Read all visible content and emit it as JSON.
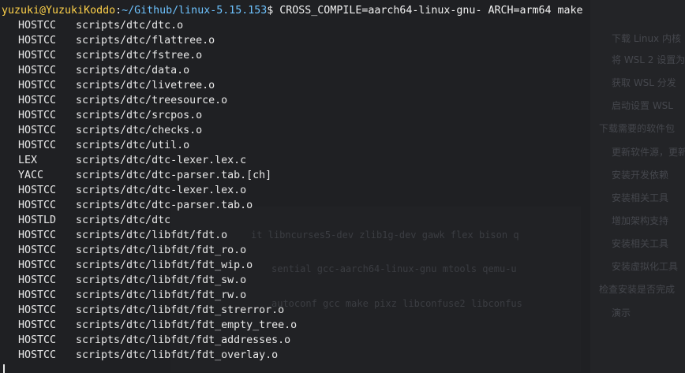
{
  "prompt": {
    "user_host": "yuzuki@YuzukiKoddo",
    "separator": ":",
    "cwd": "~/Github/linux-5.15.153",
    "symbol": "$",
    "command": " CROSS_COMPILE=aarch64-linux-gnu- ARCH=arm64 make"
  },
  "output_lines": [
    {
      "tag": "HOSTCC",
      "path": "scripts/dtc/dtc.o"
    },
    {
      "tag": "HOSTCC",
      "path": "scripts/dtc/flattree.o"
    },
    {
      "tag": "HOSTCC",
      "path": "scripts/dtc/fstree.o"
    },
    {
      "tag": "HOSTCC",
      "path": "scripts/dtc/data.o"
    },
    {
      "tag": "HOSTCC",
      "path": "scripts/dtc/livetree.o"
    },
    {
      "tag": "HOSTCC",
      "path": "scripts/dtc/treesource.o"
    },
    {
      "tag": "HOSTCC",
      "path": "scripts/dtc/srcpos.o"
    },
    {
      "tag": "HOSTCC",
      "path": "scripts/dtc/checks.o"
    },
    {
      "tag": "HOSTCC",
      "path": "scripts/dtc/util.o"
    },
    {
      "tag": "LEX",
      "path": "scripts/dtc/dtc-lexer.lex.c"
    },
    {
      "tag": "YACC",
      "path": "scripts/dtc/dtc-parser.tab.[ch]"
    },
    {
      "tag": "HOSTCC",
      "path": "scripts/dtc/dtc-lexer.lex.o"
    },
    {
      "tag": "HOSTCC",
      "path": "scripts/dtc/dtc-parser.tab.o"
    },
    {
      "tag": "HOSTLD",
      "path": "scripts/dtc/dtc"
    },
    {
      "tag": "HOSTCC",
      "path": "scripts/dtc/libfdt/fdt.o"
    },
    {
      "tag": "HOSTCC",
      "path": "scripts/dtc/libfdt/fdt_ro.o"
    },
    {
      "tag": "HOSTCC",
      "path": "scripts/dtc/libfdt/fdt_wip.o"
    },
    {
      "tag": "HOSTCC",
      "path": "scripts/dtc/libfdt/fdt_sw.o"
    },
    {
      "tag": "HOSTCC",
      "path": "scripts/dtc/libfdt/fdt_rw.o"
    },
    {
      "tag": "HOSTCC",
      "path": "scripts/dtc/libfdt/fdt_strerror.o"
    },
    {
      "tag": "HOSTCC",
      "path": "scripts/dtc/libfdt/fdt_empty_tree.o"
    },
    {
      "tag": "HOSTCC",
      "path": "scripts/dtc/libfdt/fdt_addresses.o"
    },
    {
      "tag": "HOSTCC",
      "path": "scripts/dtc/libfdt/fdt_overlay.o"
    }
  ],
  "background_window": {
    "sidebar_items": [
      "下载 Linux 内核",
      "将 WSL 2 设置为",
      "获取 WSL 分发",
      "启动设置 WSL",
      "下载需要的软件包",
      "更新软件源，更新",
      "安装开发依赖",
      "安装相关工具",
      "增加架构支持",
      "安装相关工具",
      "安装虚拟化工具",
      "检查安装是否完成",
      "演示"
    ],
    "code_lines": [
      "it libncurses5-dev zlib1g-dev gawk flex bison q",
      "sential gcc-aarch64-linux-gnu mtools qemu-u",
      "autoconf gcc make pixz libconfuse2 libconfus"
    ]
  },
  "colors": {
    "background": "#1f2023",
    "user_host": "#ffd24a",
    "cwd": "#6ec3ff",
    "text": "#e8e8e8"
  }
}
